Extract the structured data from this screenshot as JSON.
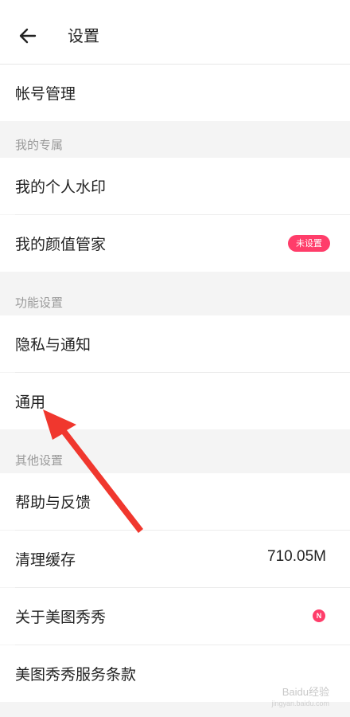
{
  "header": {
    "title": "设置",
    "back_icon": "arrow-left-icon"
  },
  "sections": [
    {
      "title": "",
      "items": [
        {
          "label": "帐号管理"
        }
      ]
    },
    {
      "title": "我的专属",
      "items": [
        {
          "label": "我的个人水印"
        },
        {
          "label": "我的颜值管家",
          "badge": "未设置"
        }
      ]
    },
    {
      "title": "功能设置",
      "items": [
        {
          "label": "隐私与通知"
        },
        {
          "label": "通用"
        }
      ]
    },
    {
      "title": "其他设置",
      "items": [
        {
          "label": "帮助与反馈"
        },
        {
          "label": "清理缓存",
          "value": "710.05M"
        },
        {
          "label": "关于美图秀秀",
          "dot": "N"
        },
        {
          "label": "美图秀秀服务条款"
        }
      ]
    }
  ],
  "annotation": {
    "arrow_color": "#f0372e",
    "points_to": "通用"
  },
  "watermark": {
    "text": "Baidu经验",
    "sub": "jingyan.baidu.com"
  },
  "colors": {
    "accent": "#ff3d6a",
    "background": "#f4f4f4"
  }
}
